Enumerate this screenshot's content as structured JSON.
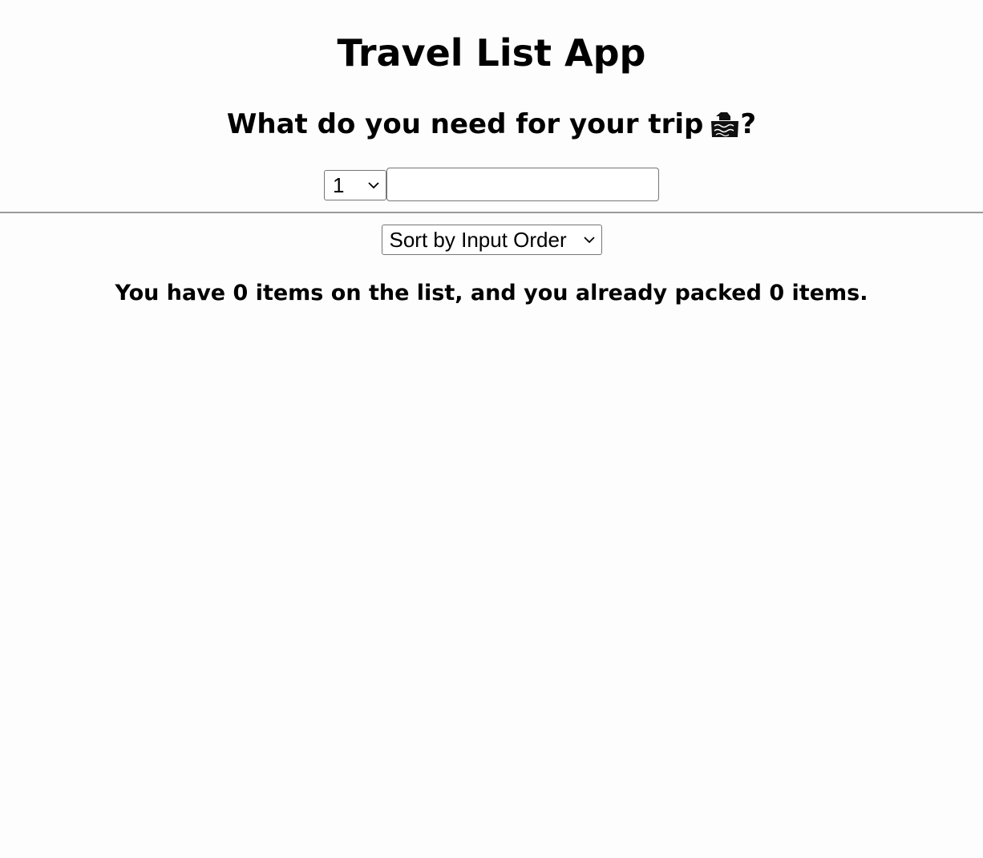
{
  "app": {
    "title": "Travel List App"
  },
  "form": {
    "question": "What do you need for your trip",
    "question_suffix": "?",
    "trip_icon": "suitcase-icon",
    "quantity_value": "1",
    "item_value": "",
    "item_placeholder": ""
  },
  "list": {
    "sort_value": "Sort by Input Order"
  },
  "stats": {
    "message": "You have 0 items on the list, and you already packed 0 items."
  }
}
